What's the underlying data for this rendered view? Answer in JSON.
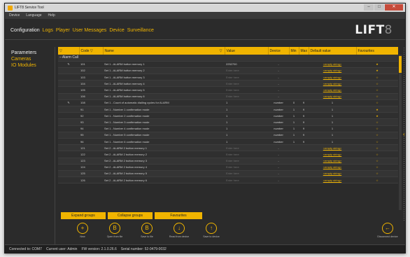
{
  "window": {
    "title": "LIFT8 Service Tool"
  },
  "menu": [
    "Device",
    "Language",
    "Help"
  ],
  "tabs": [
    {
      "label": "Configuration",
      "active": true
    },
    {
      "label": "Logs",
      "active": false
    },
    {
      "label": "Player",
      "active": false
    },
    {
      "label": "User Messages",
      "active": false
    },
    {
      "label": "Device",
      "active": false
    },
    {
      "label": "Surveillance",
      "active": false
    }
  ],
  "logo": {
    "main": "LIFT",
    "num": "8"
  },
  "left_nav": [
    {
      "label": "Parameters",
      "active": true
    },
    {
      "label": "Cameras",
      "active": false
    },
    {
      "label": "IO Modules",
      "active": false
    }
  ],
  "grid": {
    "headers": [
      "",
      "Code",
      "Name",
      "Value",
      "Device",
      "Min",
      "Max",
      "Default value",
      "Favourites"
    ],
    "group": "Alarm Call",
    "rows": [
      {
        "code": "101",
        "name": "Set 1 - ALARM button memory 1",
        "value": "2252700",
        "device": "-",
        "min": "",
        "max": "",
        "def": "<empty string>",
        "fav": "★",
        "edit": true
      },
      {
        "code": "102",
        "name": "Set 1 - ALARM button memory 2",
        "value": "Enter here",
        "device": "-",
        "min": "",
        "max": "",
        "def": "<empty string>",
        "fav": "★",
        "edit": false
      },
      {
        "code": "103",
        "name": "Set 1 - ALARM button memory 3",
        "value": "Enter here",
        "device": "-",
        "min": "",
        "max": "",
        "def": "<empty string>",
        "fav": "☆",
        "edit": false
      },
      {
        "code": "104",
        "name": "Set 1 - ALARM button memory 4",
        "value": "Enter here",
        "device": "-",
        "min": "",
        "max": "",
        "def": "<empty string>",
        "fav": "☆",
        "edit": false
      },
      {
        "code": "105",
        "name": "Set 1 - ALARM button memory 5",
        "value": "Enter here",
        "device": "-",
        "min": "",
        "max": "",
        "def": "<empty string>",
        "fav": "☆",
        "edit": false
      },
      {
        "code": "106",
        "name": "Set 1 - ALARM button memory 6",
        "value": "Enter here",
        "device": "-",
        "min": "",
        "max": "",
        "def": "<empty string>",
        "fav": "☆",
        "edit": false
      },
      {
        "code": "108",
        "name": "Set 1 - Count of automatic dialling cycles for ALARM",
        "value": "1",
        "device": "number",
        "min": "0",
        "max": "9",
        "def": "1",
        "fav": "☆",
        "edit": true
      },
      {
        "code": "91",
        "name": "Set 1 - Number 1 confirmation mode",
        "value": "1",
        "device": "number",
        "min": "1",
        "max": "9",
        "def": "1",
        "fav": "★",
        "edit": false
      },
      {
        "code": "92",
        "name": "Set 1 - Number 2 confirmation mode",
        "value": "1",
        "device": "number",
        "min": "1",
        "max": "9",
        "def": "1",
        "fav": "★",
        "edit": false
      },
      {
        "code": "93",
        "name": "Set 1 - Number 3 confirmation mode",
        "value": "1",
        "device": "number",
        "min": "1",
        "max": "9",
        "def": "1",
        "fav": "☆",
        "edit": false
      },
      {
        "code": "94",
        "name": "Set 1 - Number 4 confirmation mode",
        "value": "1",
        "device": "number",
        "min": "1",
        "max": "9",
        "def": "1",
        "fav": "☆",
        "edit": false
      },
      {
        "code": "95",
        "name": "Set 1 - Number 5 confirmation mode",
        "value": "1",
        "device": "number",
        "min": "1",
        "max": "9",
        "def": "1",
        "fav": "☆",
        "edit": false
      },
      {
        "code": "96",
        "name": "Set 1 - Number 6 confirmation mode",
        "value": "1",
        "device": "number",
        "min": "1",
        "max": "9",
        "def": "1",
        "fav": "☆",
        "edit": false
      },
      {
        "code": "121",
        "name": "Set 2 - ALARM 2 button memory 1",
        "value": "Enter here",
        "device": "-",
        "min": "",
        "max": "",
        "def": "<empty string>",
        "fav": "☆",
        "edit": false
      },
      {
        "code": "122",
        "name": "Set 2 - ALARM 2 button memory 2",
        "value": "Enter here",
        "device": "-",
        "min": "",
        "max": "",
        "def": "<empty string>",
        "fav": "☆",
        "edit": false
      },
      {
        "code": "123",
        "name": "Set 2 - ALARM 2 button memory 3",
        "value": "Enter here",
        "device": "-",
        "min": "",
        "max": "",
        "def": "<empty string>",
        "fav": "☆",
        "edit": false
      },
      {
        "code": "124",
        "name": "Set 2 - ALARM 2 button memory 4",
        "value": "Enter here",
        "device": "-",
        "min": "",
        "max": "",
        "def": "<empty string>",
        "fav": "☆",
        "edit": false
      },
      {
        "code": "125",
        "name": "Set 2 - ALARM 2 button memory 5",
        "value": "Enter here",
        "device": "-",
        "min": "",
        "max": "",
        "def": "<empty string>",
        "fav": "☆",
        "edit": false
      },
      {
        "code": "126",
        "name": "Set 2 - ALARM 2 button memory 6",
        "value": "Enter here",
        "device": "-",
        "min": "",
        "max": "",
        "def": "<empty string>",
        "fav": "☆",
        "edit": false
      }
    ]
  },
  "group_buttons": [
    "Expand groups",
    "Collapse groups",
    "Favourites"
  ],
  "actions": [
    {
      "icon": "+",
      "label": "New",
      "name": "new"
    },
    {
      "icon": "B",
      "label": "Open from file",
      "name": "open-from-file"
    },
    {
      "icon": "B",
      "label": "Save to file",
      "name": "save-to-file"
    },
    {
      "icon": "↓",
      "label": "Read from device",
      "name": "read-from-device"
    },
    {
      "icon": "↑",
      "label": "Save to device",
      "name": "save-to-device"
    }
  ],
  "disconnect": {
    "icon": "←",
    "label": "Disconnect device"
  },
  "status": {
    "connection": "Connected to: COM7",
    "user": "Current user: Admin",
    "fw": "FW version: 2.1.0.26.6",
    "serial": "Serial number: 52-0479-0032"
  },
  "colors": {
    "accent": "#f0b400",
    "bg": "#2b2b2b"
  }
}
